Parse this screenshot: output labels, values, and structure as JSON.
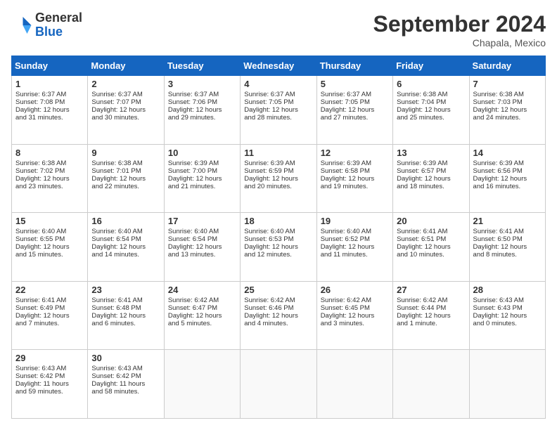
{
  "header": {
    "logo_general": "General",
    "logo_blue": "Blue",
    "month_title": "September 2024",
    "location": "Chapala, Mexico"
  },
  "days_of_week": [
    "Sunday",
    "Monday",
    "Tuesday",
    "Wednesday",
    "Thursday",
    "Friday",
    "Saturday"
  ],
  "weeks": [
    [
      {
        "day": "1",
        "lines": [
          "Sunrise: 6:37 AM",
          "Sunset: 7:08 PM",
          "Daylight: 12 hours",
          "and 31 minutes."
        ]
      },
      {
        "day": "2",
        "lines": [
          "Sunrise: 6:37 AM",
          "Sunset: 7:07 PM",
          "Daylight: 12 hours",
          "and 30 minutes."
        ]
      },
      {
        "day": "3",
        "lines": [
          "Sunrise: 6:37 AM",
          "Sunset: 7:06 PM",
          "Daylight: 12 hours",
          "and 29 minutes."
        ]
      },
      {
        "day": "4",
        "lines": [
          "Sunrise: 6:37 AM",
          "Sunset: 7:05 PM",
          "Daylight: 12 hours",
          "and 28 minutes."
        ]
      },
      {
        "day": "5",
        "lines": [
          "Sunrise: 6:37 AM",
          "Sunset: 7:05 PM",
          "Daylight: 12 hours",
          "and 27 minutes."
        ]
      },
      {
        "day": "6",
        "lines": [
          "Sunrise: 6:38 AM",
          "Sunset: 7:04 PM",
          "Daylight: 12 hours",
          "and 25 minutes."
        ]
      },
      {
        "day": "7",
        "lines": [
          "Sunrise: 6:38 AM",
          "Sunset: 7:03 PM",
          "Daylight: 12 hours",
          "and 24 minutes."
        ]
      }
    ],
    [
      {
        "day": "8",
        "lines": [
          "Sunrise: 6:38 AM",
          "Sunset: 7:02 PM",
          "Daylight: 12 hours",
          "and 23 minutes."
        ]
      },
      {
        "day": "9",
        "lines": [
          "Sunrise: 6:38 AM",
          "Sunset: 7:01 PM",
          "Daylight: 12 hours",
          "and 22 minutes."
        ]
      },
      {
        "day": "10",
        "lines": [
          "Sunrise: 6:39 AM",
          "Sunset: 7:00 PM",
          "Daylight: 12 hours",
          "and 21 minutes."
        ]
      },
      {
        "day": "11",
        "lines": [
          "Sunrise: 6:39 AM",
          "Sunset: 6:59 PM",
          "Daylight: 12 hours",
          "and 20 minutes."
        ]
      },
      {
        "day": "12",
        "lines": [
          "Sunrise: 6:39 AM",
          "Sunset: 6:58 PM",
          "Daylight: 12 hours",
          "and 19 minutes."
        ]
      },
      {
        "day": "13",
        "lines": [
          "Sunrise: 6:39 AM",
          "Sunset: 6:57 PM",
          "Daylight: 12 hours",
          "and 18 minutes."
        ]
      },
      {
        "day": "14",
        "lines": [
          "Sunrise: 6:39 AM",
          "Sunset: 6:56 PM",
          "Daylight: 12 hours",
          "and 16 minutes."
        ]
      }
    ],
    [
      {
        "day": "15",
        "lines": [
          "Sunrise: 6:40 AM",
          "Sunset: 6:55 PM",
          "Daylight: 12 hours",
          "and 15 minutes."
        ]
      },
      {
        "day": "16",
        "lines": [
          "Sunrise: 6:40 AM",
          "Sunset: 6:54 PM",
          "Daylight: 12 hours",
          "and 14 minutes."
        ]
      },
      {
        "day": "17",
        "lines": [
          "Sunrise: 6:40 AM",
          "Sunset: 6:54 PM",
          "Daylight: 12 hours",
          "and 13 minutes."
        ]
      },
      {
        "day": "18",
        "lines": [
          "Sunrise: 6:40 AM",
          "Sunset: 6:53 PM",
          "Daylight: 12 hours",
          "and 12 minutes."
        ]
      },
      {
        "day": "19",
        "lines": [
          "Sunrise: 6:40 AM",
          "Sunset: 6:52 PM",
          "Daylight: 12 hours",
          "and 11 minutes."
        ]
      },
      {
        "day": "20",
        "lines": [
          "Sunrise: 6:41 AM",
          "Sunset: 6:51 PM",
          "Daylight: 12 hours",
          "and 10 minutes."
        ]
      },
      {
        "day": "21",
        "lines": [
          "Sunrise: 6:41 AM",
          "Sunset: 6:50 PM",
          "Daylight: 12 hours",
          "and 8 minutes."
        ]
      }
    ],
    [
      {
        "day": "22",
        "lines": [
          "Sunrise: 6:41 AM",
          "Sunset: 6:49 PM",
          "Daylight: 12 hours",
          "and 7 minutes."
        ]
      },
      {
        "day": "23",
        "lines": [
          "Sunrise: 6:41 AM",
          "Sunset: 6:48 PM",
          "Daylight: 12 hours",
          "and 6 minutes."
        ]
      },
      {
        "day": "24",
        "lines": [
          "Sunrise: 6:42 AM",
          "Sunset: 6:47 PM",
          "Daylight: 12 hours",
          "and 5 minutes."
        ]
      },
      {
        "day": "25",
        "lines": [
          "Sunrise: 6:42 AM",
          "Sunset: 6:46 PM",
          "Daylight: 12 hours",
          "and 4 minutes."
        ]
      },
      {
        "day": "26",
        "lines": [
          "Sunrise: 6:42 AM",
          "Sunset: 6:45 PM",
          "Daylight: 12 hours",
          "and 3 minutes."
        ]
      },
      {
        "day": "27",
        "lines": [
          "Sunrise: 6:42 AM",
          "Sunset: 6:44 PM",
          "Daylight: 12 hours",
          "and 1 minute."
        ]
      },
      {
        "day": "28",
        "lines": [
          "Sunrise: 6:43 AM",
          "Sunset: 6:43 PM",
          "Daylight: 12 hours",
          "and 0 minutes."
        ]
      }
    ],
    [
      {
        "day": "29",
        "lines": [
          "Sunrise: 6:43 AM",
          "Sunset: 6:42 PM",
          "Daylight: 11 hours",
          "and 59 minutes."
        ]
      },
      {
        "day": "30",
        "lines": [
          "Sunrise: 6:43 AM",
          "Sunset: 6:42 PM",
          "Daylight: 11 hours",
          "and 58 minutes."
        ]
      },
      {
        "day": "",
        "lines": []
      },
      {
        "day": "",
        "lines": []
      },
      {
        "day": "",
        "lines": []
      },
      {
        "day": "",
        "lines": []
      },
      {
        "day": "",
        "lines": []
      }
    ]
  ]
}
